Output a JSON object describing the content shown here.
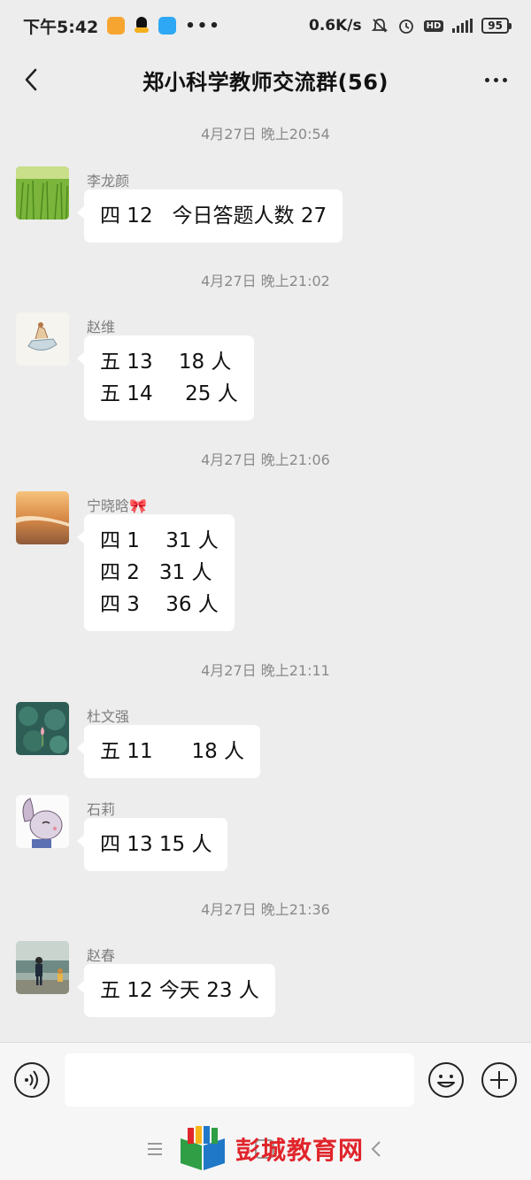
{
  "status_bar": {
    "time": "下午5:42",
    "dots": "•••",
    "speed": "0.6K/s",
    "hd": "HD",
    "network": "5G",
    "battery": "95"
  },
  "header": {
    "title": "郑小科学教师交流群(56)"
  },
  "messages": [
    {
      "timestamp": "4月27日 晚上20:54",
      "sender": "李龙颜",
      "avatar": "grass-field-avatar",
      "lines": [
        "四 12   今日答题人数 27"
      ]
    },
    {
      "timestamp": "4月27日 晚上21:02",
      "sender": "赵维",
      "avatar": "boat-sketch-avatar",
      "lines": [
        "五 13    18 人",
        "五 14     25 人"
      ]
    },
    {
      "timestamp": "4月27日 晚上21:06",
      "sender": "宁晓晗🎀",
      "avatar": "beach-sunset-avatar",
      "lines": [
        "四 1    31 人",
        "四 2   31 人",
        "四 3    36 人"
      ]
    },
    {
      "timestamp": "4月27日 晚上21:11",
      "sender": "杜文强",
      "avatar": "lotus-pond-avatar",
      "lines": [
        "五 11      18 人"
      ]
    },
    {
      "sender": "石莉",
      "avatar": "bunny-cartoon-avatar",
      "lines": [
        "四 13 15 人"
      ]
    },
    {
      "timestamp": "4月27日 晚上21:36",
      "sender": "赵春",
      "avatar": "kids-lakeside-avatar",
      "lines": [
        "五 12 今天 23 人"
      ]
    }
  ],
  "input_bar": {
    "placeholder": "",
    "icons": [
      "voice-icon",
      "emoji-icon",
      "plus-icon"
    ]
  },
  "nav_bar": {
    "icons": [
      "menu-icon",
      "home-icon",
      "back-icon"
    ]
  },
  "watermark": {
    "text": "彭城教育网"
  },
  "colors": {
    "background": "#ededed",
    "bubble": "#ffffff",
    "timestamp_text": "#8a8a8a",
    "watermark_red": "#e0252b"
  }
}
